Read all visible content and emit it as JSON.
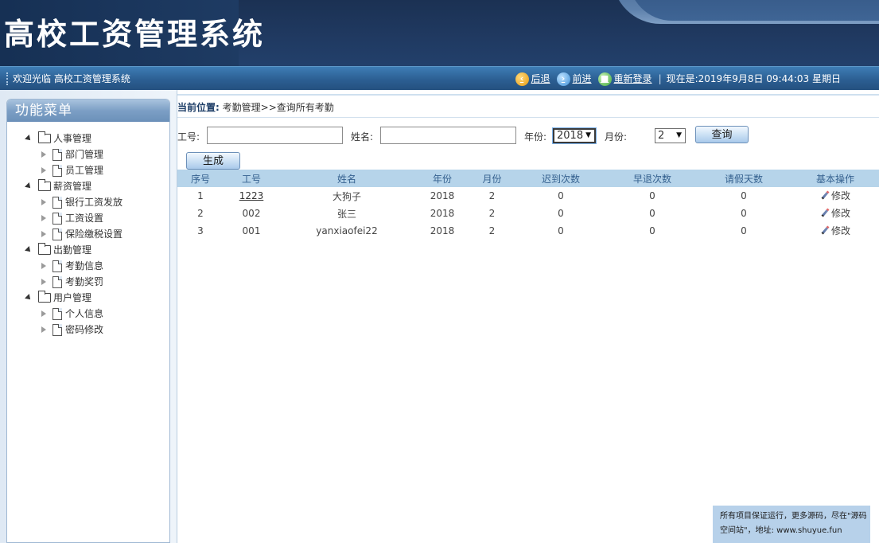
{
  "header": {
    "title": "高校工资管理系统"
  },
  "topbar": {
    "welcome": "欢迎光临 高校工资管理系统",
    "back_label": "后退",
    "forward_label": "前进",
    "relogin_label": "重新登录",
    "separator": "|",
    "now_text": "现在是:2019年9月8日 09:44:03 星期日"
  },
  "sidebar": {
    "title": "功能菜单",
    "groups": [
      {
        "label": "人事管理",
        "items": [
          {
            "label": "部门管理"
          },
          {
            "label": "员工管理"
          }
        ]
      },
      {
        "label": "薪资管理",
        "items": [
          {
            "label": "银行工资发放"
          },
          {
            "label": "工资设置"
          },
          {
            "label": "保险缴税设置"
          }
        ]
      },
      {
        "label": "出勤管理",
        "items": [
          {
            "label": "考勤信息"
          },
          {
            "label": "考勤奖罚"
          }
        ]
      },
      {
        "label": "用户管理",
        "items": [
          {
            "label": "个人信息"
          },
          {
            "label": "密码修改"
          }
        ]
      }
    ]
  },
  "breadcrumb": {
    "label": "当前位置:",
    "path": "考勤管理>>查询所有考勤"
  },
  "search": {
    "emp_no_label": "工号:",
    "emp_no_value": "",
    "name_label": "姓名:",
    "name_value": "",
    "year_label": "年份:",
    "year_value": "2018",
    "month_label": "月份:",
    "month_value": "2",
    "query_button": "查询",
    "generate_button": "生成"
  },
  "table": {
    "headers": [
      "序号",
      "工号",
      "姓名",
      "年份",
      "月份",
      "迟到次数",
      "早退次数",
      "请假天数",
      "基本操作"
    ],
    "rows": [
      {
        "index": "1",
        "emp_no": "1223",
        "name": "大狗子",
        "year": "2018",
        "month": "2",
        "late": "0",
        "early": "0",
        "leave": "0",
        "action": "修改"
      },
      {
        "index": "2",
        "emp_no": "002",
        "name": "张三",
        "year": "2018",
        "month": "2",
        "late": "0",
        "early": "0",
        "leave": "0",
        "action": "修改"
      },
      {
        "index": "3",
        "emp_no": "001",
        "name": "yanxiaofei22",
        "year": "2018",
        "month": "2",
        "late": "0",
        "early": "0",
        "leave": "0",
        "action": "修改"
      }
    ]
  },
  "notice": {
    "line1": "所有项目保证运行，更多源码，尽在\"源码",
    "line2": "空间站\"，地址: www.shuyue.fun"
  },
  "colors": {
    "header_bg": "#203a62",
    "topbar_bg": "#2c5f93",
    "table_header_bg": "#b6d4ea",
    "table_header_text": "#35618f",
    "sidebar_title_bg": "#7c9fc5"
  }
}
